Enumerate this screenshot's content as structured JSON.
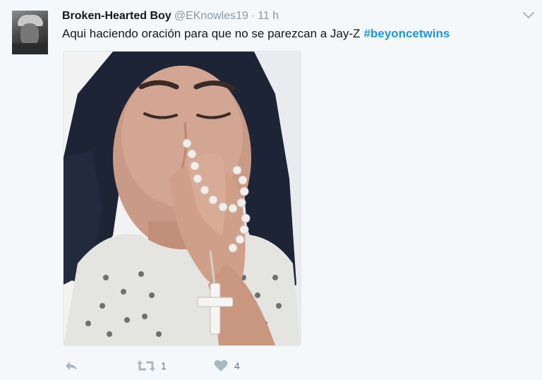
{
  "tweet": {
    "display_name": "Broken-Hearted Boy",
    "handle": "@EKnowles19",
    "separator": "·",
    "time": "11 h",
    "text": "Aqui haciendo oración para que no se parezcan a Jay-Z",
    "hashtag": "#beyoncetwins",
    "hashtag_color": "#1b95e0"
  },
  "icons": {
    "caret": "chevron-down-icon",
    "reply": "reply-icon",
    "retweet": "retweet-icon",
    "like": "heart-icon"
  },
  "actions": {
    "retweet_count": "1",
    "like_count": "4"
  }
}
